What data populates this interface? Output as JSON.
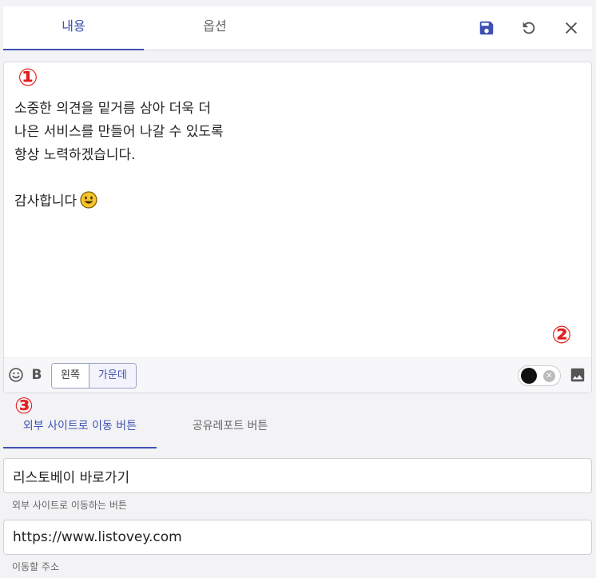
{
  "corner_badge": "1",
  "tabs": [
    {
      "label": "내용",
      "active": true
    },
    {
      "label": "옵션",
      "active": false
    }
  ],
  "toolbar_icons": [
    "save-icon",
    "undo-icon",
    "close-icon"
  ],
  "markers": [
    "①",
    "②",
    "③"
  ],
  "editor": {
    "text": "소중한 의견을 밑거름 삼아 더욱 더\n나은 서비스를 만들어 나갈 수 있도록\n항상 노력하겠습니다.\n\n감사합니다"
  },
  "editor_toolbar": {
    "icons": [
      "emoji-icon",
      "bold-icon",
      "image-icon"
    ],
    "bold_label": "B",
    "align_options": [
      {
        "label": "왼쪽",
        "active": true
      },
      {
        "label": "가운데",
        "active": false
      }
    ],
    "toggle_clear": "✕"
  },
  "subtabs": [
    {
      "label": "외부 사이트로 이동 버튼",
      "active": true
    },
    {
      "label": "공유레포트 버튼",
      "active": false
    }
  ],
  "fields": {
    "button_name": {
      "value": "리스토베이 바로가기",
      "helper": "외부 사이트로 이동하는 버튼"
    },
    "url": {
      "value": "https://www.listovey.com",
      "helper": "이동할 주소"
    }
  },
  "colors": {
    "accent": "#3f51b5",
    "marker": "#e02020"
  }
}
